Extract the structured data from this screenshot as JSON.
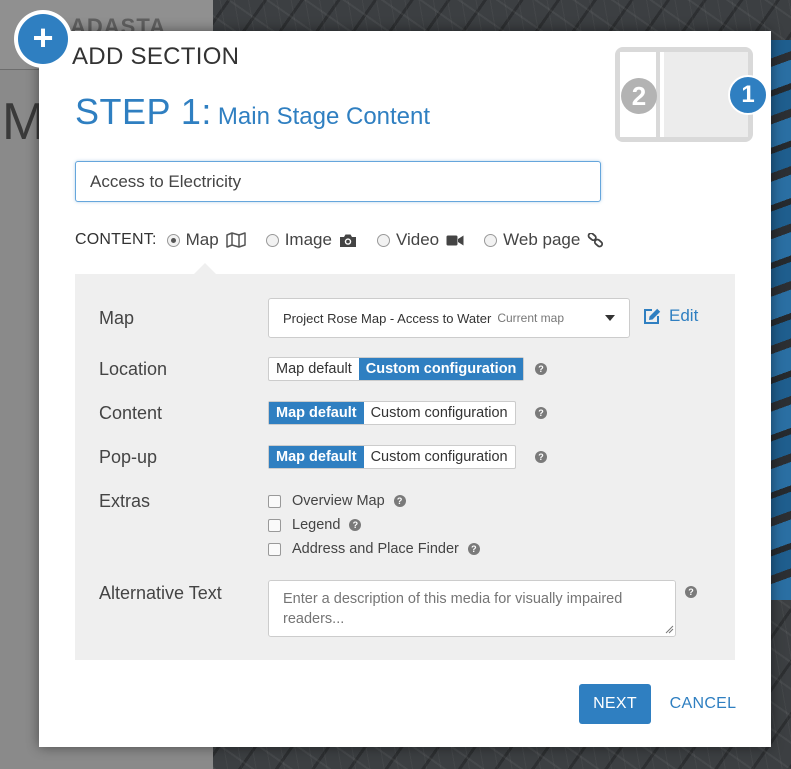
{
  "background": {
    "brand_partial": "ADASTA",
    "big_letter": "M"
  },
  "modal": {
    "title": "ADD SECTION",
    "add_icon": "plus-icon",
    "step_label": "STEP 1:",
    "step_subtitle": "Main Stage Content",
    "layout_preview": {
      "side_number": "2",
      "main_number": "1"
    },
    "section_title_value": "Access to Electricity",
    "content": {
      "label": "CONTENT:",
      "options": [
        {
          "label": "Map",
          "icon": "map-icon",
          "checked": true
        },
        {
          "label": "Image",
          "icon": "camera-icon",
          "checked": false
        },
        {
          "label": "Video",
          "icon": "video-camera-icon",
          "checked": false
        },
        {
          "label": "Web page",
          "icon": "link-icon",
          "checked": false
        }
      ]
    },
    "map_row": {
      "label": "Map",
      "selected_map": "Project Rose Map - Access to Water",
      "selected_tag": "Current map",
      "edit_label": "Edit",
      "edit_icon": "edit-icon"
    },
    "location": {
      "label": "Location",
      "opt_default": "Map default",
      "opt_custom": "Custom configuration",
      "selected": "Custom configuration"
    },
    "content_cfg": {
      "label": "Content",
      "opt_default": "Map default",
      "opt_custom": "Custom configuration",
      "selected": "Map default"
    },
    "popup": {
      "label": "Pop-up",
      "opt_default": "Map default",
      "opt_custom": "Custom configuration",
      "selected": "Map default"
    },
    "extras": {
      "label": "Extras",
      "items": [
        {
          "label": "Overview Map",
          "checked": false
        },
        {
          "label": "Legend",
          "checked": false
        },
        {
          "label": "Address and Place Finder",
          "checked": false
        }
      ]
    },
    "alt_text": {
      "label": "Alternative Text",
      "placeholder": "Enter a description of this media for visually impaired readers..."
    },
    "help_glyph": "?",
    "buttons": {
      "next": "NEXT",
      "cancel": "CANCEL"
    },
    "colors": {
      "accent": "#2f7fc1",
      "panel": "#efefef"
    }
  }
}
